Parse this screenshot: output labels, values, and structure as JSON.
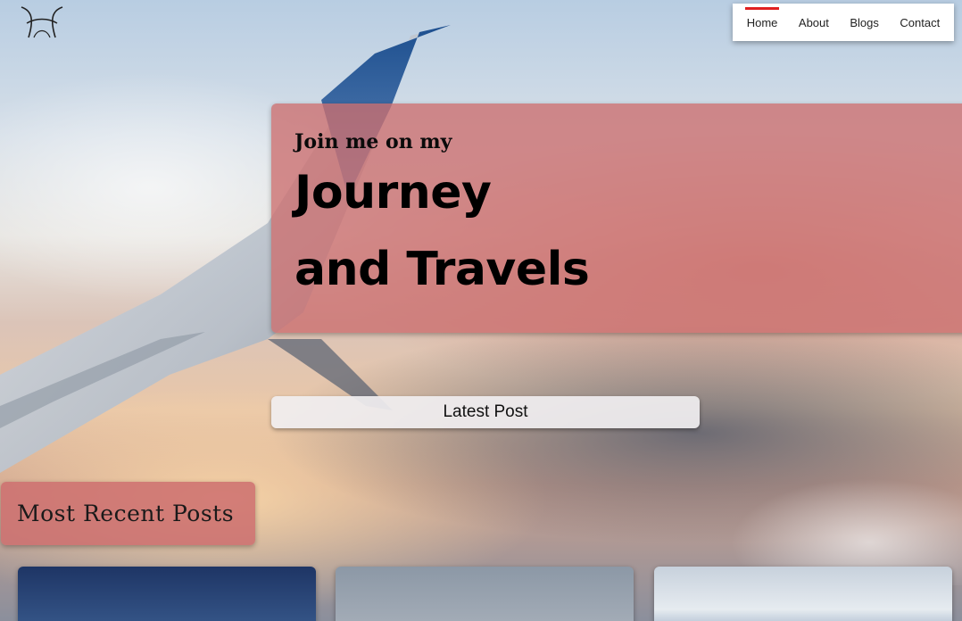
{
  "nav": {
    "items": [
      {
        "label": "Home",
        "active": true
      },
      {
        "label": "About",
        "active": false
      },
      {
        "label": "Blogs",
        "active": false
      },
      {
        "label": "Contact",
        "active": false
      }
    ],
    "active_indicator_color": "#e02020"
  },
  "hero": {
    "kicker": "Join me on my",
    "title_line1": "Journey",
    "title_line2": "and Travels",
    "card_color": "#cc6e6e"
  },
  "latest_post": {
    "label": "Latest Post"
  },
  "recent": {
    "heading": "Most Recent Posts"
  },
  "icons": {
    "logo": "logo-icon"
  }
}
